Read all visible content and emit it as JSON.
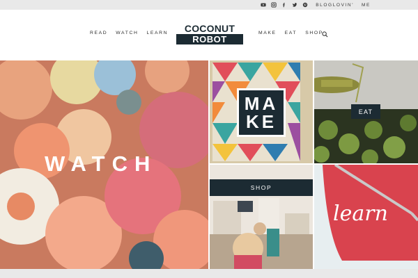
{
  "topbar": {
    "social": [
      "youtube-icon",
      "instagram-icon",
      "facebook-icon",
      "twitter-icon",
      "pinterest-icon"
    ],
    "links": [
      "BLOGLOVIN'",
      "ME"
    ]
  },
  "nav": {
    "left": [
      "READ",
      "WATCH",
      "LEARN"
    ],
    "right": [
      "MAKE",
      "EAT",
      "SHOP"
    ]
  },
  "logo": {
    "line1": "COCONUT",
    "line2": "ROBOT"
  },
  "tiles": {
    "watch": "WATCH",
    "make": [
      "MA",
      "KE"
    ],
    "eat": "EAT",
    "shop": "SHOP",
    "learn": "learn"
  },
  "colors": {
    "navy": "#1c2b33",
    "topbar": "#e9e9e9",
    "learn_red": "#d9434e"
  }
}
